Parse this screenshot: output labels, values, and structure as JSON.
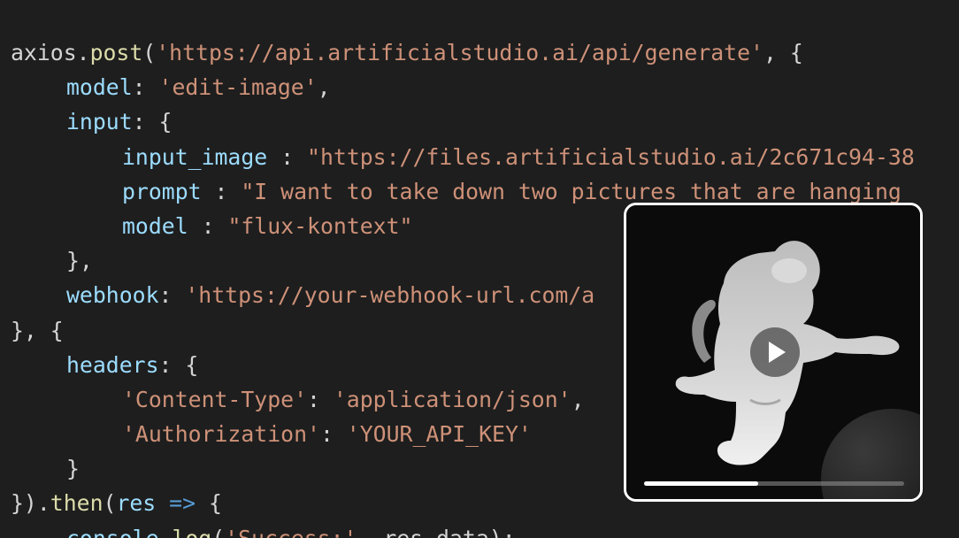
{
  "code": {
    "l1": {
      "a": "axios.",
      "b": "post",
      "c": "(",
      "d": "'https://api.artificialstudio.ai/api/generate'",
      "e": ", {"
    },
    "l2": {
      "a": "model",
      "b": ": ",
      "c": "'edit-image'",
      "d": ","
    },
    "l3": {
      "a": "input",
      "b": ": {"
    },
    "l4": {
      "a": "input_image",
      "b": " : ",
      "c": "\"https://files.artificialstudio.ai/2c671c94-38"
    },
    "l5": {
      "a": "prompt",
      "b": " : ",
      "c": "\"I want to take down two pictures that are hanging"
    },
    "l6": {
      "a": "model",
      "b": " : ",
      "c": "\"flux-kontext\""
    },
    "l7": {
      "a": "},"
    },
    "l8": {
      "a": "webhook",
      "b": ": ",
      "c": "'https://your-webhook-url.com/a"
    },
    "l9": {
      "a": "}, {"
    },
    "l10": {
      "a": "headers",
      "b": ": {"
    },
    "l11": {
      "a": "'Content-Type'",
      "b": ": ",
      "c": "'application/json'",
      "d": ","
    },
    "l12": {
      "a": "'Authorization'",
      "b": ": ",
      "c": "'YOUR_API_KEY'"
    },
    "l13": {
      "a": "}"
    },
    "l14": {
      "a": "}).",
      "b": "then",
      "c": "(",
      "d": "res",
      "e": " => ",
      "f": "{"
    },
    "l15": {
      "a": "console.",
      "b": "log",
      "c": "(",
      "d": "'Success:'",
      "e": ", res.data);"
    }
  },
  "video": {
    "progress": 0.44,
    "play_icon": "play-icon"
  },
  "colors": {
    "background": "#1e1e1e",
    "plain": "#d4d4d4",
    "function": "#dcdcaa",
    "string": "#ce9178",
    "property": "#9cdcfe",
    "keyword": "#569cd6"
  }
}
